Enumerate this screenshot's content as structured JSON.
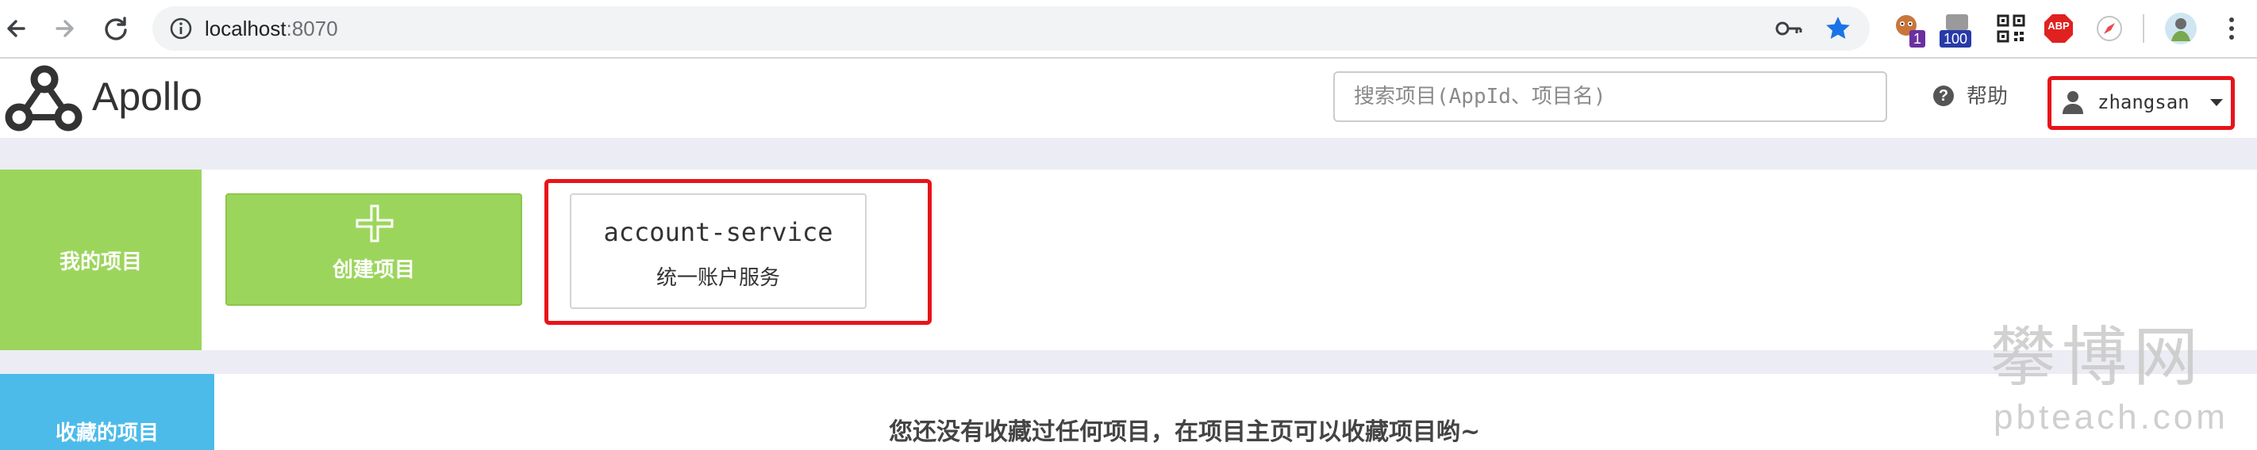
{
  "browser": {
    "url_host": "localhost",
    "url_port": ":8070",
    "extensions": {
      "tampermonkey_badge": "1",
      "counter_badge": "100",
      "abp_label": "ABP"
    }
  },
  "header": {
    "brand": "Apollo",
    "search_placeholder": "搜索项目(AppId、项目名)",
    "help_label": "帮助",
    "username": "zhangsan"
  },
  "my_projects": {
    "section_label": "我的项目",
    "create_label": "创建项目",
    "projects": [
      {
        "app_id": "account-service",
        "name": "统一账户服务"
      }
    ]
  },
  "favorites": {
    "section_label": "收藏的项目",
    "empty_message": "您还没有收藏过任何项目，在项目主页可以收藏项目哟~"
  },
  "watermark": {
    "cn": "攀博网",
    "en": "pbteach.com"
  },
  "colors": {
    "my_projects_green": "#9cd55c",
    "favorites_blue": "#4cbbea",
    "highlight_red": "#e8131a",
    "page_bg": "#ececf4"
  }
}
